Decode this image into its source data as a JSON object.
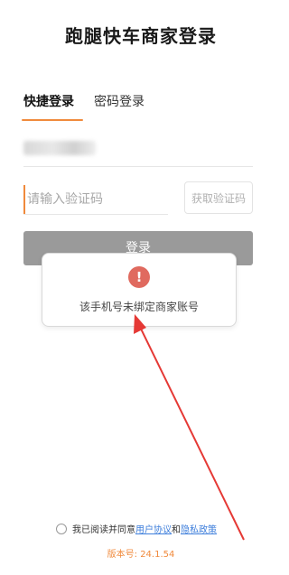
{
  "page": {
    "title": "跑腿快车商家登录"
  },
  "tabs": [
    {
      "label": "快捷登录",
      "active": true
    },
    {
      "label": "密码登录",
      "active": false
    }
  ],
  "form": {
    "code_placeholder": "请输入验证码",
    "get_code_label": "获取验证码",
    "login_label": "登录"
  },
  "toast": {
    "icon": "exclamation-icon",
    "message": "该手机号未绑定商家账号"
  },
  "agreement": {
    "prefix": "我已阅读并同意",
    "user_agreement": "用户协议",
    "and": "和",
    "privacy_policy": "隐私政策"
  },
  "version": "版本号: 24.1.54",
  "colors": {
    "accent": "#f08a3c",
    "link": "#3d7edb",
    "warning": "#e06a5f",
    "annotation": "#e53935"
  }
}
